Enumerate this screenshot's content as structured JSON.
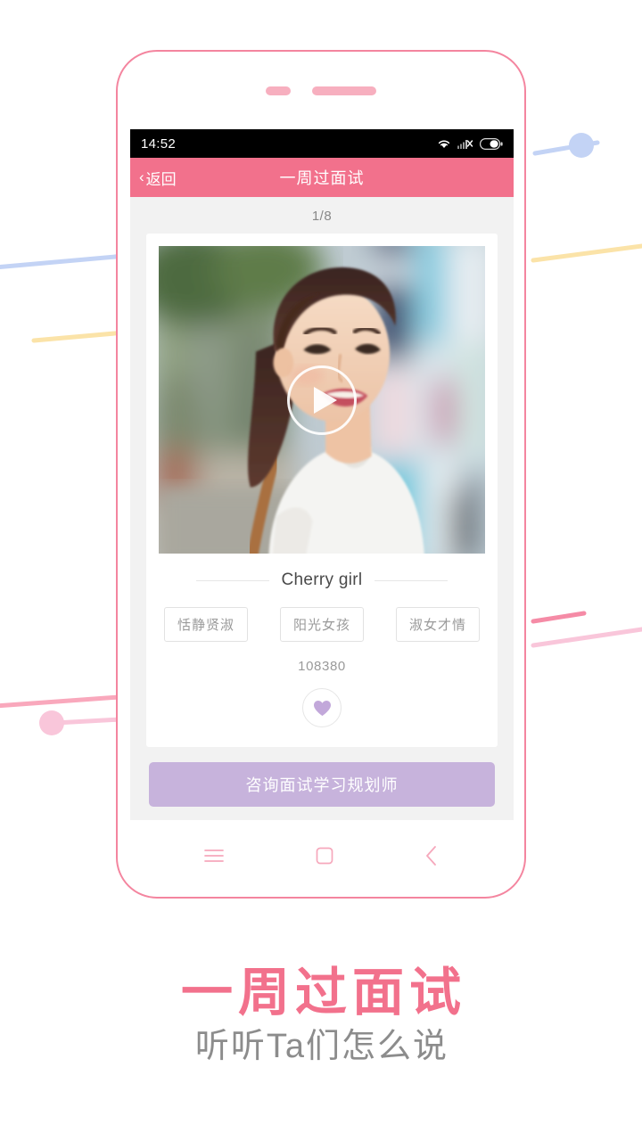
{
  "theme": {
    "pink": "#F2718C",
    "pink_light": "#F7AFBF",
    "purple": "#C7B3DC",
    "screen_bg": "#F2F2F2",
    "card_bg": "#FFFFFF",
    "muted_text": "#9A9A9A"
  },
  "phone": {
    "camera_icon": "camera-dot",
    "speaker_icon": "speaker-slot"
  },
  "statusbar": {
    "time": "14:52",
    "icons": [
      "wifi-icon",
      "cellular-signal-no-service-icon",
      "battery-icon"
    ]
  },
  "appbar": {
    "back_chevron": "‹",
    "back_label": "返回",
    "title": "一周过面试"
  },
  "content": {
    "counter": "1/8",
    "video": {
      "play_icon": "play-button-icon",
      "alt": "smiling young woman in white t-shirt on a street"
    },
    "person_name": "Cherry girl",
    "tags": [
      "恬静贤淑",
      "阳光女孩",
      "淑女才情"
    ],
    "id_number": "108380",
    "like_icon": "heart-icon"
  },
  "cta": {
    "label": "咨询面试学习规划师"
  },
  "navbar": {
    "items": [
      {
        "name": "menu-icon"
      },
      {
        "name": "home-square-icon"
      },
      {
        "name": "back-chevron-icon"
      }
    ]
  },
  "captions": {
    "headline": "一周过面试",
    "subhead": "听听Ta们怎么说"
  }
}
